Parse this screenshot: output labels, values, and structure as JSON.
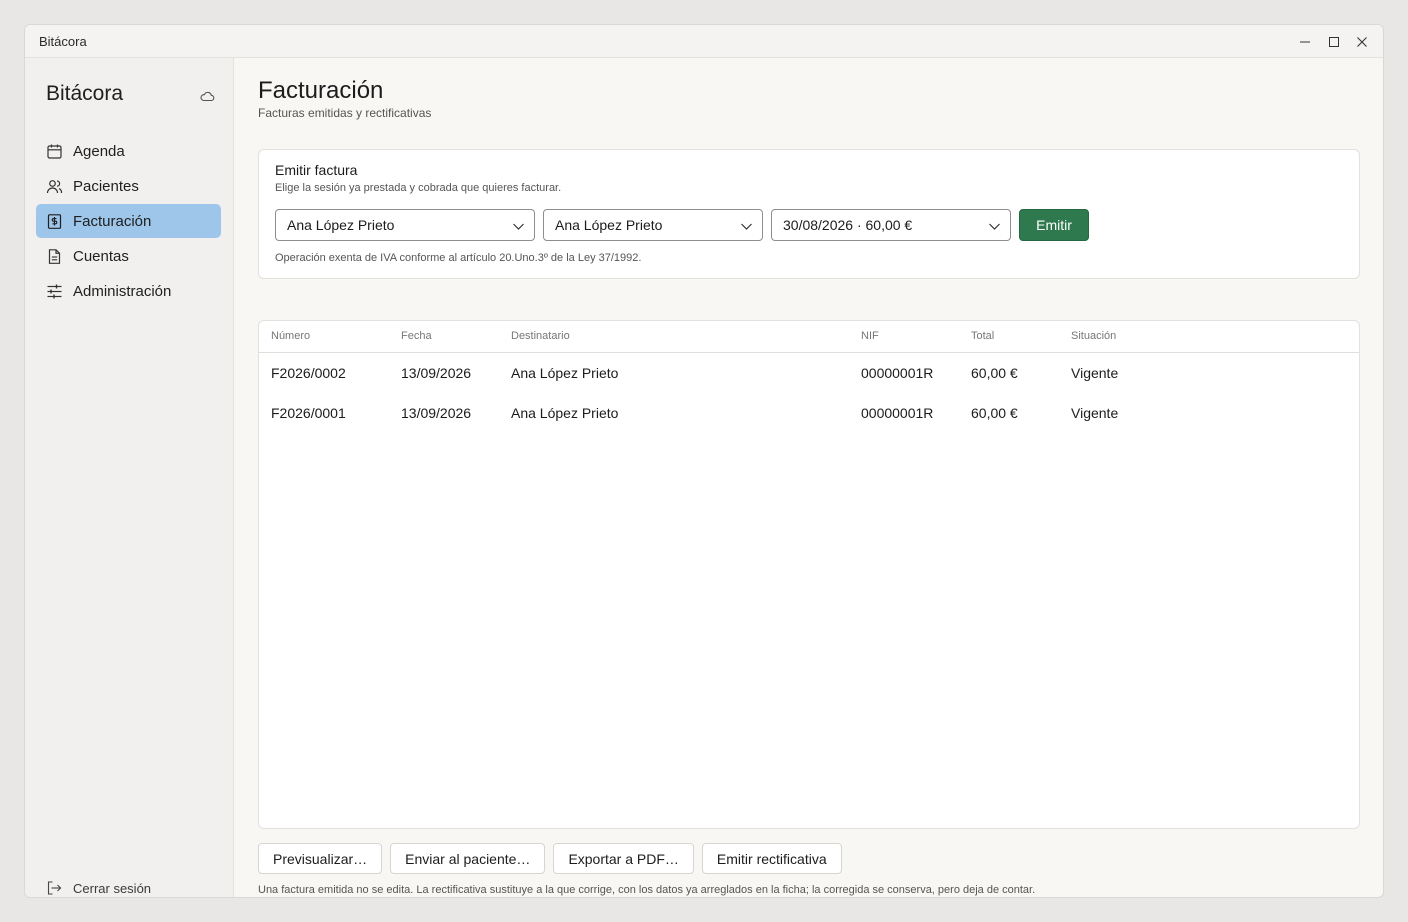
{
  "window": {
    "title": "Bitácora"
  },
  "sidebar": {
    "brand": "Bitácora",
    "items": [
      {
        "label": "Agenda",
        "icon": "calendar-icon",
        "active": false
      },
      {
        "label": "Pacientes",
        "icon": "users-icon",
        "active": false
      },
      {
        "label": "Facturación",
        "icon": "invoice-icon",
        "active": true
      },
      {
        "label": "Cuentas",
        "icon": "document-icon",
        "active": false
      },
      {
        "label": "Administración",
        "icon": "sliders-icon",
        "active": false
      }
    ],
    "logout_label": "Cerrar sesión"
  },
  "header": {
    "title": "Facturación",
    "subtitle": "Facturas emitidas y rectificativas"
  },
  "emit_card": {
    "title": "Emitir factura",
    "subtitle": "Elige la sesión ya prestada y cobrada que quieres facturar.",
    "select_patient": "Ana López Prieto",
    "select_recipient": "Ana López Prieto",
    "select_session": "30/08/2026 · 60,00 €",
    "emit_label": "Emitir",
    "note": "Operación exenta de IVA conforme al artículo 20.Uno.3º de la Ley 37/1992."
  },
  "table": {
    "columns": [
      "Número",
      "Fecha",
      "Destinatario",
      "NIF",
      "Total",
      "Situación"
    ],
    "rows": [
      [
        "F2026/0002",
        "13/09/2026",
        "Ana López Prieto",
        "00000001R",
        "60,00 €",
        "Vigente"
      ],
      [
        "F2026/0001",
        "13/09/2026",
        "Ana López Prieto",
        "00000001R",
        "60,00 €",
        "Vigente"
      ]
    ]
  },
  "actions": {
    "preview": "Previsualizar…",
    "send": "Enviar al paciente…",
    "export": "Exportar a PDF…",
    "rectify": "Emitir rectificativa"
  },
  "footnote": "Una factura emitida no se edita. La rectificativa sustituye a la que corrige, con los datos ya arreglados en la ficha; la corregida se conserva, pero deja de contar.",
  "colors": {
    "accent_nav": "#9ec6ea",
    "emit_button": "#2e7a4e"
  }
}
